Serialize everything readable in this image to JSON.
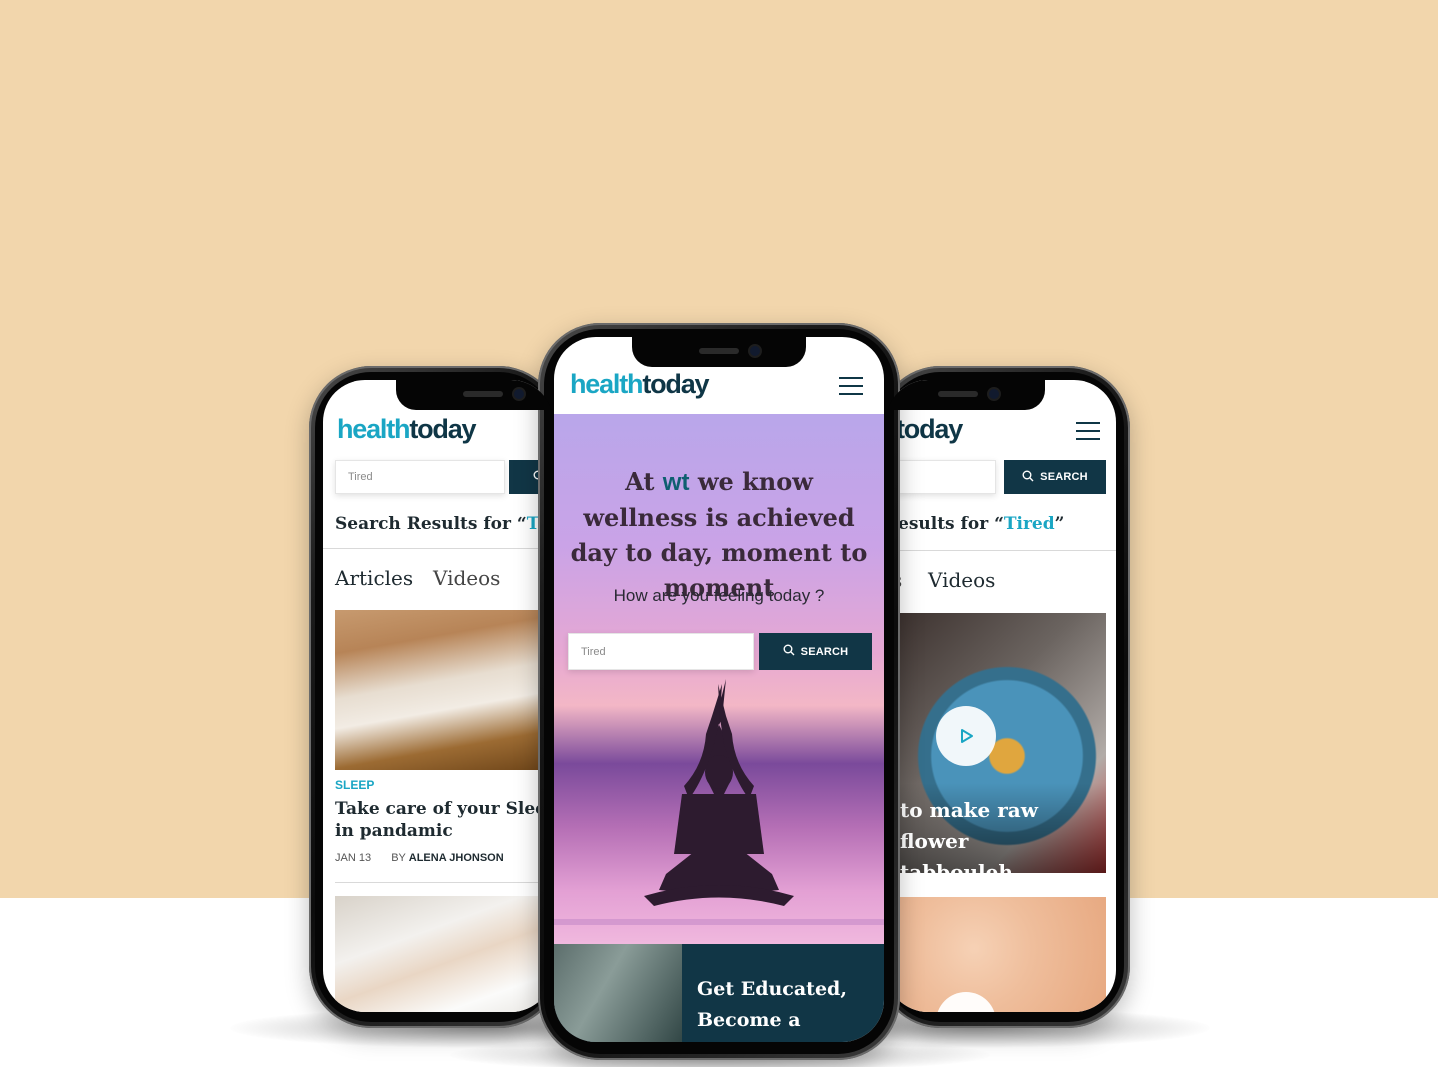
{
  "brand": {
    "part1": "health",
    "part2": "today"
  },
  "colors": {
    "background_top": "#f2d6ac",
    "accent": "#1aa6c4",
    "dark": "#113646"
  },
  "search": {
    "value": "Tired",
    "button_label": "SEARCH"
  },
  "left_phone": {
    "results_prefix": "Search Results for “",
    "results_term": "Tired",
    "results_suffix": "”",
    "tabs": [
      {
        "label": "Articles"
      },
      {
        "label": "Videos"
      }
    ],
    "article": {
      "category": "SLEEP",
      "title": "Take care of your Sleep in pandamic",
      "date": "JAN 13",
      "by": "BY",
      "author": "ALENA JHONSON"
    }
  },
  "center_phone": {
    "hero_pre": "At",
    "hero_brand": "wt",
    "hero_post": "we know wellness is achieved day to day, moment to moment",
    "subtitle": "How are you feeling today ?",
    "promo_title": "Get Educated, Become a Health"
  },
  "right_phone": {
    "brand_partial": "today",
    "results_prefix": "esults for “",
    "results_term": "Tired",
    "results_suffix": "”",
    "tab_partial": "s",
    "tab_videos": "Videos",
    "video_title": "to make raw flower tabbouleh"
  },
  "icons": [
    "hamburger-menu-icon",
    "search-icon",
    "play-icon"
  ]
}
